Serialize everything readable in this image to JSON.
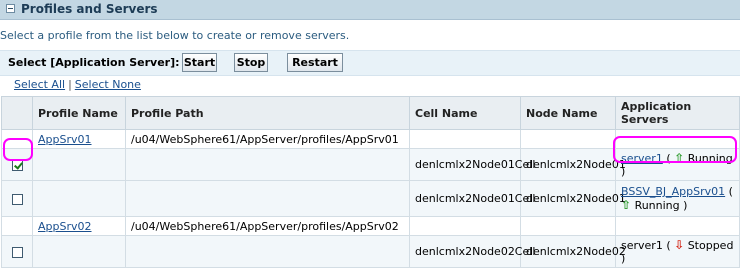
{
  "section": {
    "title": "Profiles and Servers"
  },
  "instruction": "Select a profile from the list below to create or remove servers.",
  "actions": {
    "label": "Select [Application Server]:",
    "start": "Start",
    "stop": "Stop",
    "restart": "Restart"
  },
  "selection": {
    "select_all": "Select All",
    "separator": "|",
    "select_none": "Select None"
  },
  "table": {
    "headers": [
      "",
      "Profile Name",
      "Profile Path",
      "Cell Name",
      "Node Name",
      "Application Servers"
    ],
    "rows": [
      {
        "profile": "AppSrv01",
        "path": "/u04/WebSphere61/AppServer/profiles/AppSrv01"
      },
      {
        "checked": true,
        "cell": "denlcmlx2Node01Cell",
        "node": "denlcmlx2Node01",
        "server": "server1",
        "status": "Running",
        "status_icon": "up-arrow-icon"
      },
      {
        "checked": false,
        "cell": "denlcmlx2Node01Cell",
        "node": "denlcmlx2Node01",
        "server": "BSSV_BJ_AppSrv01",
        "status": "Running",
        "status_icon": "up-arrow-icon"
      },
      {
        "profile": "AppSrv02",
        "path": "/u04/WebSphere61/AppServer/profiles/AppSrv02"
      },
      {
        "checked": false,
        "cell": "denlcmlx2Node02Cell",
        "node": "denlcmlx2Node02",
        "server": "server1",
        "status": "Stopped",
        "status_icon": "down-arrow-icon"
      }
    ]
  },
  "colors": {
    "header_bg": "#c3d7e3",
    "link": "#1a4f8e",
    "highlight": "#ff00ff",
    "running": "#2e9b2e",
    "stopped": "#d42a1b"
  }
}
